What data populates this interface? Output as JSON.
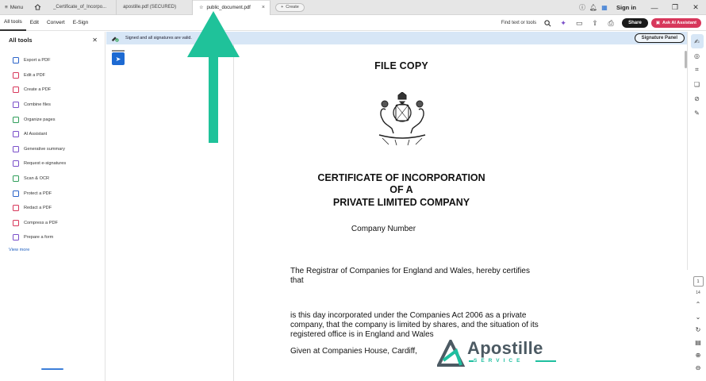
{
  "tabbar": {
    "menu_label": "Menu",
    "tabs": [
      {
        "label": "_Certificate_of_Incorpo..."
      },
      {
        "label": "apostille.pdf (SECURED)"
      },
      {
        "label": "public_document.pdf",
        "close": "×"
      }
    ],
    "create_label": "Create",
    "sign_in": "Sign in"
  },
  "toolbar": {
    "items": [
      "All tools",
      "Edit",
      "Convert",
      "E-Sign"
    ],
    "find_label": "Find text or tools",
    "share_label": "Share",
    "ai_label": "Ask AI Assistant"
  },
  "left_panel": {
    "title": "All tools",
    "items": [
      {
        "label": "Export a PDF",
        "color": "#2a63c9"
      },
      {
        "label": "Edit a PDF",
        "color": "#d7375b"
      },
      {
        "label": "Create a PDF",
        "color": "#d7375b"
      },
      {
        "label": "Combine files",
        "color": "#7a4fc9"
      },
      {
        "label": "Organize pages",
        "color": "#2f9e5a"
      },
      {
        "label": "AI Assistant",
        "color": "#7a4fc9"
      },
      {
        "label": "Generative summary",
        "color": "#7a4fc9"
      },
      {
        "label": "Request e-signatures",
        "color": "#7a4fc9"
      },
      {
        "label": "Scan & OCR",
        "color": "#2f9e5a"
      },
      {
        "label": "Protect a PDF",
        "color": "#2a63c9"
      },
      {
        "label": "Redact a PDF",
        "color": "#d7375b"
      },
      {
        "label": "Compress a PDF",
        "color": "#d7375b"
      },
      {
        "label": "Prepare a form",
        "color": "#7a4fc9"
      }
    ],
    "view_more": "View more"
  },
  "signature_bar": {
    "message": "Signed and all signatures are valid.",
    "panel_button": "Signature Panel"
  },
  "document": {
    "title": "FILE COPY",
    "heading_lines": [
      "CERTIFICATE OF INCORPORATION",
      "OF A",
      "PRIVATE LIMITED COMPANY"
    ],
    "company_number_label": "Company Number",
    "para1_lines": [
      "The Registrar of Companies for England and Wales, hereby certifies",
      "that"
    ],
    "para2_lines": [
      "is this day incorporated under the Companies Act 2006 as a private",
      "company, that the company is limited by shares, and the situation of its",
      "registered office is in England and Wales"
    ],
    "para3": "Given at Companies House, Cardiff,",
    "watermark_word": "Apostille",
    "watermark_sub": "SERVICE"
  },
  "page_nav": {
    "current": "1",
    "total": "14"
  },
  "colors": {
    "accent_ai": "#d7375b",
    "signature_bar_bg": "#d7e6f6",
    "arrow": "#1fc29a",
    "select_tool": "#1d6ad2"
  }
}
